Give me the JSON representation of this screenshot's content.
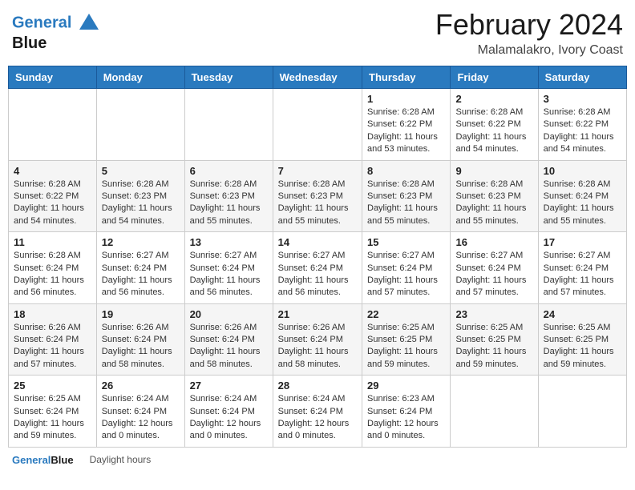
{
  "header": {
    "month_title": "February 2024",
    "location": "Malamalakro, Ivory Coast",
    "logo_line1": "General",
    "logo_line2": "Blue"
  },
  "days_of_week": [
    "Sunday",
    "Monday",
    "Tuesday",
    "Wednesday",
    "Thursday",
    "Friday",
    "Saturday"
  ],
  "weeks": [
    [
      {
        "day": "",
        "info": ""
      },
      {
        "day": "",
        "info": ""
      },
      {
        "day": "",
        "info": ""
      },
      {
        "day": "",
        "info": ""
      },
      {
        "day": "1",
        "info": "Sunrise: 6:28 AM\nSunset: 6:22 PM\nDaylight: 11 hours and 53 minutes."
      },
      {
        "day": "2",
        "info": "Sunrise: 6:28 AM\nSunset: 6:22 PM\nDaylight: 11 hours and 54 minutes."
      },
      {
        "day": "3",
        "info": "Sunrise: 6:28 AM\nSunset: 6:22 PM\nDaylight: 11 hours and 54 minutes."
      }
    ],
    [
      {
        "day": "4",
        "info": "Sunrise: 6:28 AM\nSunset: 6:22 PM\nDaylight: 11 hours and 54 minutes."
      },
      {
        "day": "5",
        "info": "Sunrise: 6:28 AM\nSunset: 6:23 PM\nDaylight: 11 hours and 54 minutes."
      },
      {
        "day": "6",
        "info": "Sunrise: 6:28 AM\nSunset: 6:23 PM\nDaylight: 11 hours and 55 minutes."
      },
      {
        "day": "7",
        "info": "Sunrise: 6:28 AM\nSunset: 6:23 PM\nDaylight: 11 hours and 55 minutes."
      },
      {
        "day": "8",
        "info": "Sunrise: 6:28 AM\nSunset: 6:23 PM\nDaylight: 11 hours and 55 minutes."
      },
      {
        "day": "9",
        "info": "Sunrise: 6:28 AM\nSunset: 6:23 PM\nDaylight: 11 hours and 55 minutes."
      },
      {
        "day": "10",
        "info": "Sunrise: 6:28 AM\nSunset: 6:24 PM\nDaylight: 11 hours and 55 minutes."
      }
    ],
    [
      {
        "day": "11",
        "info": "Sunrise: 6:28 AM\nSunset: 6:24 PM\nDaylight: 11 hours and 56 minutes."
      },
      {
        "day": "12",
        "info": "Sunrise: 6:27 AM\nSunset: 6:24 PM\nDaylight: 11 hours and 56 minutes."
      },
      {
        "day": "13",
        "info": "Sunrise: 6:27 AM\nSunset: 6:24 PM\nDaylight: 11 hours and 56 minutes."
      },
      {
        "day": "14",
        "info": "Sunrise: 6:27 AM\nSunset: 6:24 PM\nDaylight: 11 hours and 56 minutes."
      },
      {
        "day": "15",
        "info": "Sunrise: 6:27 AM\nSunset: 6:24 PM\nDaylight: 11 hours and 57 minutes."
      },
      {
        "day": "16",
        "info": "Sunrise: 6:27 AM\nSunset: 6:24 PM\nDaylight: 11 hours and 57 minutes."
      },
      {
        "day": "17",
        "info": "Sunrise: 6:27 AM\nSunset: 6:24 PM\nDaylight: 11 hours and 57 minutes."
      }
    ],
    [
      {
        "day": "18",
        "info": "Sunrise: 6:26 AM\nSunset: 6:24 PM\nDaylight: 11 hours and 57 minutes."
      },
      {
        "day": "19",
        "info": "Sunrise: 6:26 AM\nSunset: 6:24 PM\nDaylight: 11 hours and 58 minutes."
      },
      {
        "day": "20",
        "info": "Sunrise: 6:26 AM\nSunset: 6:24 PM\nDaylight: 11 hours and 58 minutes."
      },
      {
        "day": "21",
        "info": "Sunrise: 6:26 AM\nSunset: 6:24 PM\nDaylight: 11 hours and 58 minutes."
      },
      {
        "day": "22",
        "info": "Sunrise: 6:25 AM\nSunset: 6:25 PM\nDaylight: 11 hours and 59 minutes."
      },
      {
        "day": "23",
        "info": "Sunrise: 6:25 AM\nSunset: 6:25 PM\nDaylight: 11 hours and 59 minutes."
      },
      {
        "day": "24",
        "info": "Sunrise: 6:25 AM\nSunset: 6:25 PM\nDaylight: 11 hours and 59 minutes."
      }
    ],
    [
      {
        "day": "25",
        "info": "Sunrise: 6:25 AM\nSunset: 6:24 PM\nDaylight: 11 hours and 59 minutes."
      },
      {
        "day": "26",
        "info": "Sunrise: 6:24 AM\nSunset: 6:24 PM\nDaylight: 12 hours and 0 minutes."
      },
      {
        "day": "27",
        "info": "Sunrise: 6:24 AM\nSunset: 6:24 PM\nDaylight: 12 hours and 0 minutes."
      },
      {
        "day": "28",
        "info": "Sunrise: 6:24 AM\nSunset: 6:24 PM\nDaylight: 12 hours and 0 minutes."
      },
      {
        "day": "29",
        "info": "Sunrise: 6:23 AM\nSunset: 6:24 PM\nDaylight: 12 hours and 0 minutes."
      },
      {
        "day": "",
        "info": ""
      },
      {
        "day": "",
        "info": ""
      }
    ]
  ],
  "footer": {
    "logo_line1": "General",
    "logo_line2": "Blue",
    "note": "Daylight hours"
  }
}
